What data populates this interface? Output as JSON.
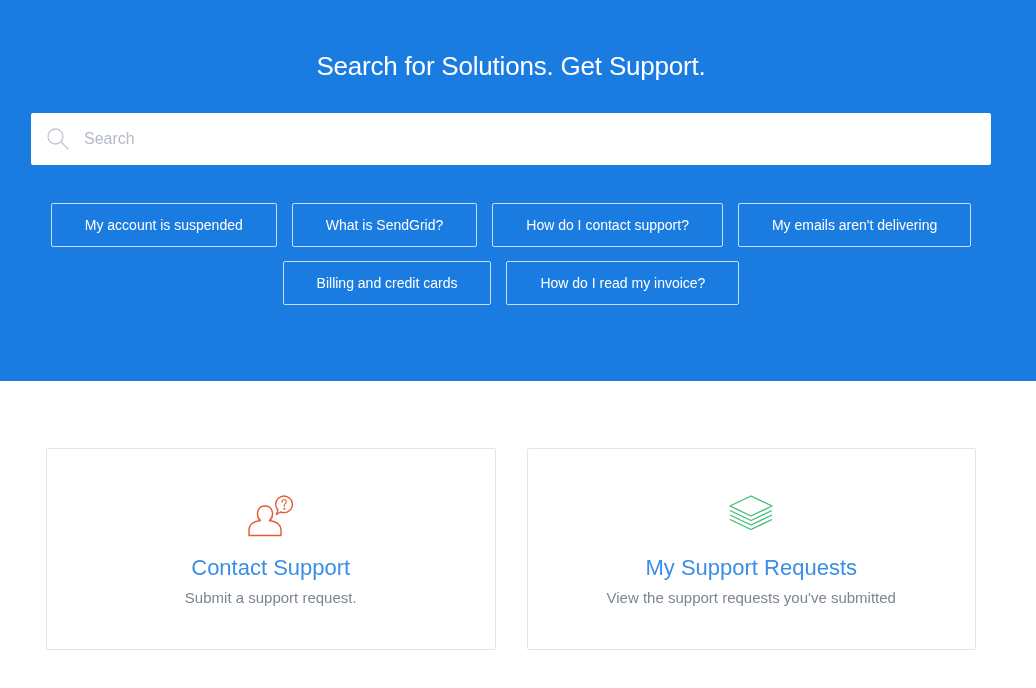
{
  "hero": {
    "title": "Search for Solutions. Get Support.",
    "search": {
      "placeholder": "Search"
    },
    "quick_link_rows": [
      [
        "My account is suspended",
        "What is SendGrid?",
        "How do I contact support?",
        "My emails aren't delivering"
      ],
      [
        "Billing and credit cards",
        "How do I read my invoice?"
      ]
    ]
  },
  "cards": [
    {
      "title": "Contact Support",
      "description": "Submit a support request."
    },
    {
      "title": "My Support Requests",
      "description": "View the support requests you've submitted"
    }
  ]
}
